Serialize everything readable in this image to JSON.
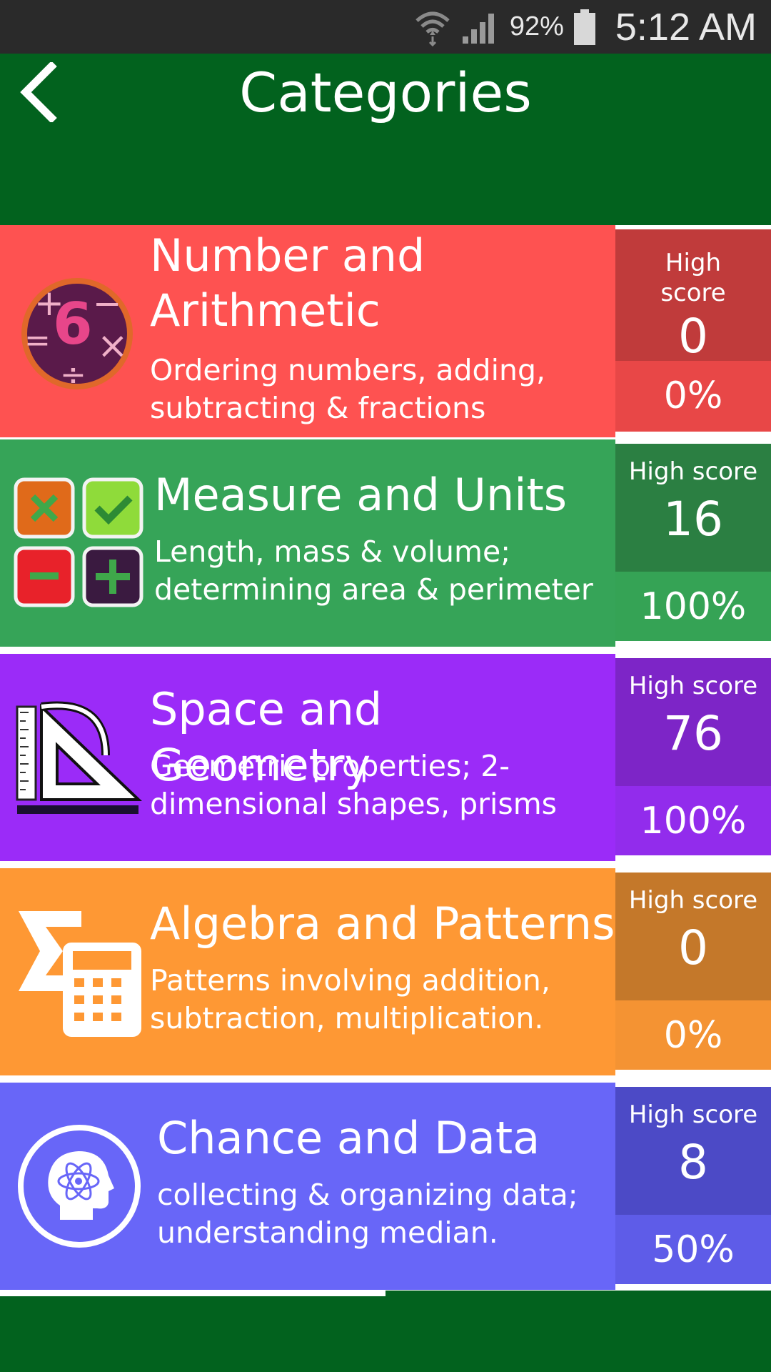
{
  "status_bar": {
    "battery_percent": "92%",
    "time": "5:12 AM"
  },
  "header": {
    "title": "Categories"
  },
  "categories": [
    {
      "title_line1": "Number and",
      "title_line2": "Arithmetic",
      "desc_line1": "Ordering numbers, adding,",
      "desc_line2": "subtracting & fractions",
      "score_label_line1": "High",
      "score_label_line2": "score",
      "high_score": "0",
      "percent": "0%",
      "icon": "math-operations-icon",
      "colors": {
        "main": "#fe5251",
        "score_top": "#c03b3b",
        "score_bottom": "#e84747"
      }
    },
    {
      "title": "Measure and Units",
      "desc_line1": "Length, mass & volume;",
      "desc_line2": "determining area & perimeter",
      "score_label": "High score",
      "high_score": "16",
      "percent": "100%",
      "icon": "calculator-keys-icon",
      "colors": {
        "main": "#36a458",
        "score_top": "#2b7f42",
        "score_bottom": "#35a355"
      }
    },
    {
      "title": "Space and Geometry",
      "desc_line1": "Geometric properties; 2-",
      "desc_line2": "dimensional shapes, prisms",
      "score_label": "High score",
      "high_score": "76",
      "percent": "100%",
      "icon": "ruler-triangle-icon",
      "colors": {
        "main": "#9b2bf8",
        "score_top": "#7d25c7",
        "score_bottom": "#922cec"
      }
    },
    {
      "title": "Algebra and Patterns",
      "desc_line1": "Patterns involving addition,",
      "desc_line2": "subtraction, multiplication.",
      "score_label": "High score",
      "high_score": "0",
      "percent": "0%",
      "icon": "sigma-calculator-icon",
      "colors": {
        "main": "#fe9834",
        "score_top": "#c4782a",
        "score_bottom": "#f49333"
      }
    },
    {
      "title": "Chance and Data",
      "desc_line1": "collecting & organizing data;",
      "desc_line2": "understanding median.",
      "score_label": "High score",
      "high_score": "8",
      "percent": "50%",
      "icon": "atom-head-icon",
      "colors": {
        "main": "#6866f8",
        "score_top": "#4c4ac6",
        "score_bottom": "#5e5ce8"
      }
    }
  ]
}
